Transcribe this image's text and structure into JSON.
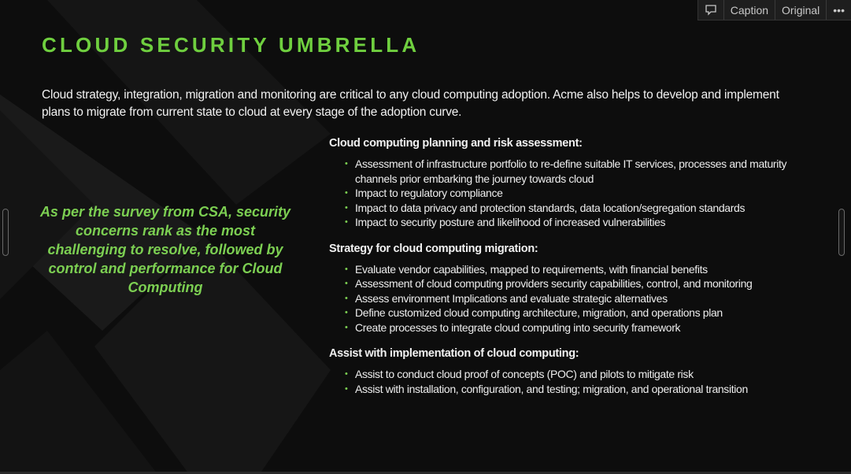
{
  "toolbar": {
    "comment_icon": "comment-icon",
    "caption_label": "Caption",
    "original_label": "Original",
    "more_label": "•••"
  },
  "slide": {
    "title": "CLOUD SECURITY UMBRELLA",
    "intro": "Cloud strategy, integration, migration and monitoring are critical to any cloud computing adoption. Acme also helps to develop and implement plans to migrate from current state to cloud at every stage of the adoption curve.",
    "quote": "As per the survey from CSA, security concerns rank as the most challenging to resolve, followed by control and performance for Cloud Computing",
    "bullet_char": "•",
    "sections": [
      {
        "heading": "Cloud computing planning and risk assessment:",
        "items": [
          "Assessment of infrastructure portfolio to re-define suitable IT services, processes and maturity channels prior embarking the journey towards cloud",
          "Impact to regulatory compliance",
          "Impact to data privacy and protection standards, data location/segregation standards",
          "Impact to security posture and likelihood of increased vulnerabilities"
        ]
      },
      {
        "heading": "Strategy for cloud computing migration:",
        "items": [
          "Evaluate vendor capabilities, mapped to requirements, with financial benefits",
          "Assessment of cloud computing providers security capabilities, control, and monitoring",
          "Assess environment Implications and evaluate strategic alternatives",
          "Define customized cloud computing architecture, migration, and operations plan",
          "Create processes to integrate cloud computing into security framework"
        ]
      },
      {
        "heading": "Assist with implementation of cloud computing:",
        "items": [
          "Assist to conduct cloud proof of concepts (POC) and pilots to mitigate risk",
          "Assist with installation, configuration, and testing; migration, and operational transition"
        ]
      }
    ]
  },
  "colors": {
    "accent_green": "#6fcf3f",
    "background": "#0d0d0d",
    "text": "#f2f2f2"
  }
}
